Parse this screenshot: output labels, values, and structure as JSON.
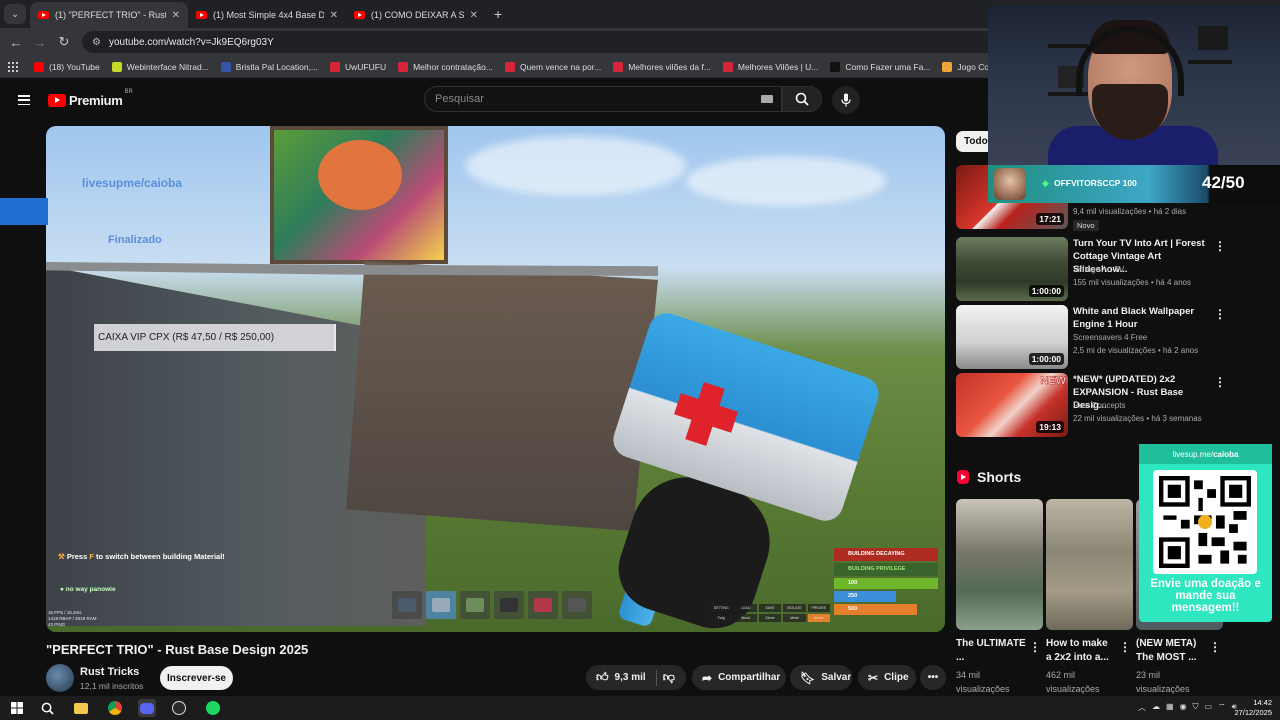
{
  "browser": {
    "tabs": [
      {
        "label": "(1) \"PERFECT TRIO\" - Rust Base",
        "active": true
      },
      {
        "label": "(1) Most Simple 4x4 Base Design",
        "active": false
      },
      {
        "label": "(1) COMO DEIXAR A SUA CASA",
        "active": false
      }
    ],
    "url": "youtube.com/watch?v=Jk9EQ6rg03Y",
    "bookmarks": [
      {
        "label": "(18) YouTube",
        "color": "#ff0000"
      },
      {
        "label": "Webinterface Nitrad...",
        "color": "#c6d82a"
      },
      {
        "label": "Bristla Pal Location,...",
        "color": "#3355aa"
      },
      {
        "label": "UwUFUFU",
        "color": "#d8243a"
      },
      {
        "label": "Melhor contratação...",
        "color": "#d8243a"
      },
      {
        "label": "Quem vence na por...",
        "color": "#d8243a"
      },
      {
        "label": "Melhores vilões da f...",
        "color": "#d8243a"
      },
      {
        "label": "Melhores Vilões | U...",
        "color": "#d8243a"
      },
      {
        "label": "Como Fazer uma Fa...",
        "color": "#111111"
      },
      {
        "label": "Jogo Conexões Esp...",
        "color": "#f2a43a"
      }
    ]
  },
  "yt_header": {
    "logo_text": "Premium",
    "region": "BR",
    "search_placeholder": "Pesquisar"
  },
  "video_overlay": {
    "link": "livesupme/caioba",
    "vip": "CAIXA VIP CPX (R$ 47,50 / R$ 250,00)",
    "status": "Finalizado",
    "hint_pre": "Press ",
    "hint_key": "F",
    "hint_post": " to switch between building Material!",
    "chat": "no way panowie",
    "fps": [
      "16 FPS / 16.2ms",
      "1419 RBAP / 2019 RAM",
      "43 PING"
    ],
    "status_panel": {
      "decay": "BUILDING DECAYING",
      "privilege": "BUILDING PRIVILEGE",
      "bars": [
        "100",
        "250",
        "500"
      ]
    },
    "build_menu": [
      "SETTING",
      "LOAD",
      "SAVE",
      "ISOLATE",
      "PRIVATE",
      "Twig",
      "Wood",
      "Stone",
      "Metal",
      "Armor"
    ]
  },
  "video": {
    "title": "\"PERFECT TRIO\" - Rust Base Design 2025",
    "channel": "Rust Tricks",
    "subscribers": "12,1 mil inscritos",
    "subscribe_label": "Inscrever-se",
    "likes": "9,3 mil",
    "share_label": "Compartilhar",
    "save_label": "Salvar",
    "clip_label": "Clipe"
  },
  "sidebar": {
    "chip": "Todos",
    "recommendations": [
      {
        "title": "",
        "channel": "",
        "meta": "9,4 mil visualizações • há 2 dias",
        "duration": "17:21",
        "badge": "Novo",
        "thumb": "red"
      },
      {
        "title": "Turn Your TV Into Art | Forest Cottage Vintage Art Slideshow...",
        "channel": "Vintage Art TV",
        "meta": "155 mil visualizações • há 4 anos",
        "duration": "1:00:00",
        "badge": "",
        "thumb": "forest"
      },
      {
        "title": "White and Black Wallpaper Engine 1 Hour",
        "channel": "Screensavers 4 Free",
        "meta": "2,5 mi de visualizações • há 2 anos",
        "duration": "1:00:00",
        "badge": "",
        "thumb": "white"
      },
      {
        "title": "*NEW* (UPDATED) 2x2 EXPANSION - Rust Base Desig...",
        "channel": "Rust Concepts",
        "meta": "22 mil visualizações • há 3 semanas",
        "duration": "19:13",
        "badge": "NEW",
        "thumb": "rust"
      }
    ],
    "shorts_heading": "Shorts",
    "shorts": [
      {
        "title": "The ULTIMATE ...",
        "views": "34 mil visualizações"
      },
      {
        "title": "How to make a 2x2 into a...",
        "views": "462 mil visualizações"
      },
      {
        "title": "(NEW META) The MOST ...",
        "views": "23 mil visualizações"
      }
    ]
  },
  "stream": {
    "sub_name": "OFFVITORSCCP",
    "sub_amount": "100",
    "goal": "42/50",
    "donate_url_prefix": "livesup.me/",
    "donate_url_name": "caioba",
    "donate_message": "Envie uma doação e mande sua mensagem!!"
  },
  "taskbar": {
    "time": "14:42",
    "date": "27/12/2025"
  }
}
